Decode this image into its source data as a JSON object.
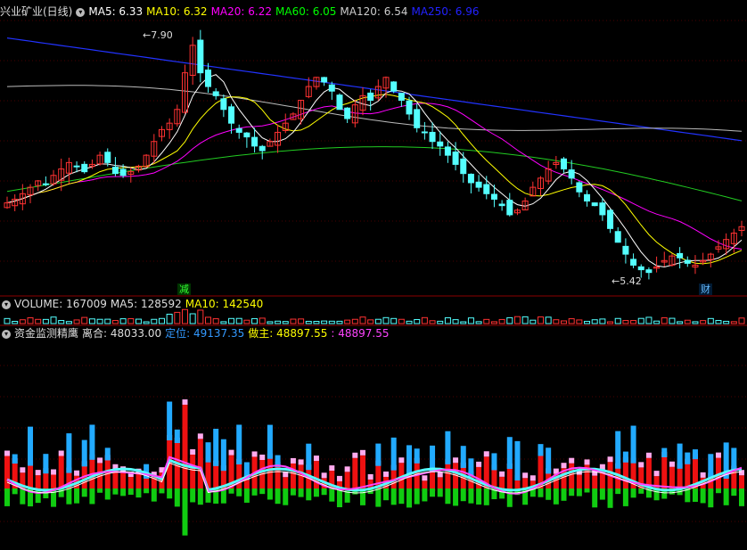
{
  "stock": {
    "title": "兴业矿业(日线)",
    "ma": [
      {
        "label": "MA5:",
        "value": "6.33",
        "color": "#ffffff"
      },
      {
        "label": "MA10:",
        "value": "6.32",
        "color": "#ffff00"
      },
      {
        "label": "MA20:",
        "value": "6.22",
        "color": "#ff00ff"
      },
      {
        "label": "MA60:",
        "value": "6.05",
        "color": "#00ff00"
      },
      {
        "label": "MA120:",
        "value": "6.54",
        "color": "#cccccc"
      },
      {
        "label": "MA250:",
        "value": "6.96",
        "color": "#2222ff"
      }
    ],
    "high_label": "7.90",
    "low_label": "5.42",
    "tag1": "减",
    "tag2": "财"
  },
  "volume": {
    "label": "VOLUME: 167009",
    "ma5": "MA5: 128592",
    "ma10": "MA10: 142540"
  },
  "indicator": {
    "title": "资金监测精鹰",
    "lihe": "离合: 48033.00",
    "dingwei": "定位: 49137.35",
    "zuozhu": "做主: 48897.55",
    "extra": ": 48897.55"
  },
  "chart_data": {
    "type": "candlestick",
    "price_range": [
      5.3,
      8.2
    ],
    "closes": [
      6.18,
      6.22,
      6.28,
      6.35,
      6.42,
      6.38,
      6.48,
      6.55,
      6.62,
      6.58,
      6.52,
      6.6,
      6.7,
      6.62,
      6.5,
      6.48,
      6.52,
      6.58,
      6.7,
      6.85,
      6.98,
      7.05,
      7.2,
      7.6,
      7.9,
      7.6,
      7.45,
      7.35,
      7.2,
      7.05,
      6.95,
      6.9,
      6.8,
      6.75,
      6.85,
      6.95,
      7.05,
      7.15,
      7.3,
      7.45,
      7.55,
      7.5,
      7.4,
      7.2,
      7.1,
      7.25,
      7.35,
      7.3,
      7.45,
      7.55,
      7.4,
      7.3,
      7.15,
      7.0,
      6.95,
      6.85,
      6.8,
      6.7,
      6.6,
      6.5,
      6.4,
      6.35,
      6.28,
      6.22,
      6.15,
      6.05,
      6.1,
      6.2,
      6.35,
      6.45,
      6.55,
      6.62,
      6.55,
      6.45,
      6.3,
      6.2,
      6.15,
      6.05,
      5.9,
      5.75,
      5.62,
      5.5,
      5.45,
      5.42,
      5.48,
      5.55,
      5.6,
      5.58,
      5.52,
      5.5,
      5.55,
      5.62,
      5.7,
      5.78,
      5.85,
      5.92
    ],
    "volume_ma5": 128592,
    "volume_ma10": 142540,
    "indicator_values": {
      "离合": 48033.0,
      "定位": 49137.35,
      "做主": 48897.55
    }
  }
}
